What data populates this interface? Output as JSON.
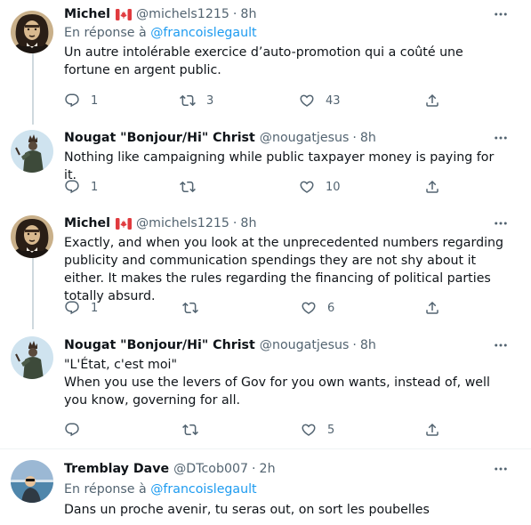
{
  "tweets": [
    {
      "name": "Michel",
      "flag": "canada-flag",
      "handle": "@michels1215",
      "sep": "·",
      "time": "8h",
      "reply_prefix": "En réponse à",
      "reply_mention": "@francoislegault",
      "text": "Un autre intolérable exercice d’auto-promotion qui a coûté une fortune en argent public.",
      "replies": "1",
      "retweets": "3",
      "likes": "43"
    },
    {
      "name": "Nougat \"Bonjour/Hi\" Christ",
      "handle": "@nougatjesus",
      "sep": "·",
      "time": "8h",
      "text": "Nothing like campaigning while public taxpayer money is paying for it.",
      "replies": "1",
      "retweets": "",
      "likes": "10"
    },
    {
      "name": "Michel",
      "flag": "canada-flag",
      "handle": "@michels1215",
      "sep": "·",
      "time": "8h",
      "text": "Exactly, and when you look at the unprecedented numbers regarding publicity and communication spendings they are not shy about it either. It makes the rules regarding the financing of political parties totally absurd.",
      "replies": "1",
      "retweets": "",
      "likes": "6"
    },
    {
      "name": "Nougat \"Bonjour/Hi\" Christ",
      "handle": "@nougatjesus",
      "sep": "·",
      "time": "8h",
      "text_line1": "\"L'État, c'est moi\"",
      "text_line2": "When you use the levers of Gov for you own wants, instead of, well you know, governing for all.",
      "replies": "",
      "retweets": "",
      "likes": "5"
    },
    {
      "name": "Tremblay Dave",
      "handle": "@DTcob007",
      "sep": "·",
      "time": "2h",
      "reply_prefix": "En réponse à",
      "reply_mention": "@francoislegault",
      "text": "Dans un proche avenir, tu seras out, on sort les poubelles"
    }
  ],
  "colors": {
    "text": "#0f1419",
    "secondary": "#536471",
    "link": "#1d9bf0",
    "thread_line": "#cfd9de",
    "divider": "#eff3f4"
  }
}
